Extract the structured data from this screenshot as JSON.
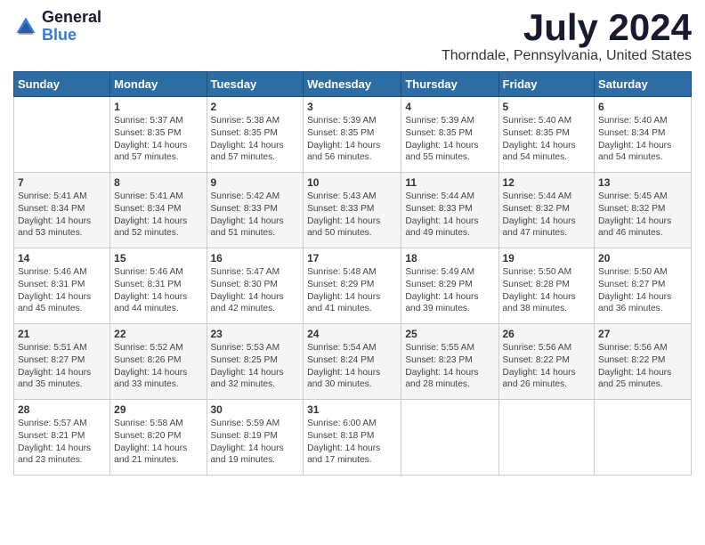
{
  "logo": {
    "general": "General",
    "blue": "Blue"
  },
  "title": {
    "month_year": "July 2024",
    "location": "Thorndale, Pennsylvania, United States"
  },
  "days_of_week": [
    "Sunday",
    "Monday",
    "Tuesday",
    "Wednesday",
    "Thursday",
    "Friday",
    "Saturday"
  ],
  "weeks": [
    [
      {
        "day": "",
        "info": ""
      },
      {
        "day": "1",
        "info": "Sunrise: 5:37 AM\nSunset: 8:35 PM\nDaylight: 14 hours\nand 57 minutes."
      },
      {
        "day": "2",
        "info": "Sunrise: 5:38 AM\nSunset: 8:35 PM\nDaylight: 14 hours\nand 57 minutes."
      },
      {
        "day": "3",
        "info": "Sunrise: 5:39 AM\nSunset: 8:35 PM\nDaylight: 14 hours\nand 56 minutes."
      },
      {
        "day": "4",
        "info": "Sunrise: 5:39 AM\nSunset: 8:35 PM\nDaylight: 14 hours\nand 55 minutes."
      },
      {
        "day": "5",
        "info": "Sunrise: 5:40 AM\nSunset: 8:35 PM\nDaylight: 14 hours\nand 54 minutes."
      },
      {
        "day": "6",
        "info": "Sunrise: 5:40 AM\nSunset: 8:34 PM\nDaylight: 14 hours\nand 54 minutes."
      }
    ],
    [
      {
        "day": "7",
        "info": "Sunrise: 5:41 AM\nSunset: 8:34 PM\nDaylight: 14 hours\nand 53 minutes."
      },
      {
        "day": "8",
        "info": "Sunrise: 5:41 AM\nSunset: 8:34 PM\nDaylight: 14 hours\nand 52 minutes."
      },
      {
        "day": "9",
        "info": "Sunrise: 5:42 AM\nSunset: 8:33 PM\nDaylight: 14 hours\nand 51 minutes."
      },
      {
        "day": "10",
        "info": "Sunrise: 5:43 AM\nSunset: 8:33 PM\nDaylight: 14 hours\nand 50 minutes."
      },
      {
        "day": "11",
        "info": "Sunrise: 5:44 AM\nSunset: 8:33 PM\nDaylight: 14 hours\nand 49 minutes."
      },
      {
        "day": "12",
        "info": "Sunrise: 5:44 AM\nSunset: 8:32 PM\nDaylight: 14 hours\nand 47 minutes."
      },
      {
        "day": "13",
        "info": "Sunrise: 5:45 AM\nSunset: 8:32 PM\nDaylight: 14 hours\nand 46 minutes."
      }
    ],
    [
      {
        "day": "14",
        "info": "Sunrise: 5:46 AM\nSunset: 8:31 PM\nDaylight: 14 hours\nand 45 minutes."
      },
      {
        "day": "15",
        "info": "Sunrise: 5:46 AM\nSunset: 8:31 PM\nDaylight: 14 hours\nand 44 minutes."
      },
      {
        "day": "16",
        "info": "Sunrise: 5:47 AM\nSunset: 8:30 PM\nDaylight: 14 hours\nand 42 minutes."
      },
      {
        "day": "17",
        "info": "Sunrise: 5:48 AM\nSunset: 8:29 PM\nDaylight: 14 hours\nand 41 minutes."
      },
      {
        "day": "18",
        "info": "Sunrise: 5:49 AM\nSunset: 8:29 PM\nDaylight: 14 hours\nand 39 minutes."
      },
      {
        "day": "19",
        "info": "Sunrise: 5:50 AM\nSunset: 8:28 PM\nDaylight: 14 hours\nand 38 minutes."
      },
      {
        "day": "20",
        "info": "Sunrise: 5:50 AM\nSunset: 8:27 PM\nDaylight: 14 hours\nand 36 minutes."
      }
    ],
    [
      {
        "day": "21",
        "info": "Sunrise: 5:51 AM\nSunset: 8:27 PM\nDaylight: 14 hours\nand 35 minutes."
      },
      {
        "day": "22",
        "info": "Sunrise: 5:52 AM\nSunset: 8:26 PM\nDaylight: 14 hours\nand 33 minutes."
      },
      {
        "day": "23",
        "info": "Sunrise: 5:53 AM\nSunset: 8:25 PM\nDaylight: 14 hours\nand 32 minutes."
      },
      {
        "day": "24",
        "info": "Sunrise: 5:54 AM\nSunset: 8:24 PM\nDaylight: 14 hours\nand 30 minutes."
      },
      {
        "day": "25",
        "info": "Sunrise: 5:55 AM\nSunset: 8:23 PM\nDaylight: 14 hours\nand 28 minutes."
      },
      {
        "day": "26",
        "info": "Sunrise: 5:56 AM\nSunset: 8:22 PM\nDaylight: 14 hours\nand 26 minutes."
      },
      {
        "day": "27",
        "info": "Sunrise: 5:56 AM\nSunset: 8:22 PM\nDaylight: 14 hours\nand 25 minutes."
      }
    ],
    [
      {
        "day": "28",
        "info": "Sunrise: 5:57 AM\nSunset: 8:21 PM\nDaylight: 14 hours\nand 23 minutes."
      },
      {
        "day": "29",
        "info": "Sunrise: 5:58 AM\nSunset: 8:20 PM\nDaylight: 14 hours\nand 21 minutes."
      },
      {
        "day": "30",
        "info": "Sunrise: 5:59 AM\nSunset: 8:19 PM\nDaylight: 14 hours\nand 19 minutes."
      },
      {
        "day": "31",
        "info": "Sunrise: 6:00 AM\nSunset: 8:18 PM\nDaylight: 14 hours\nand 17 minutes."
      },
      {
        "day": "",
        "info": ""
      },
      {
        "day": "",
        "info": ""
      },
      {
        "day": "",
        "info": ""
      }
    ]
  ]
}
